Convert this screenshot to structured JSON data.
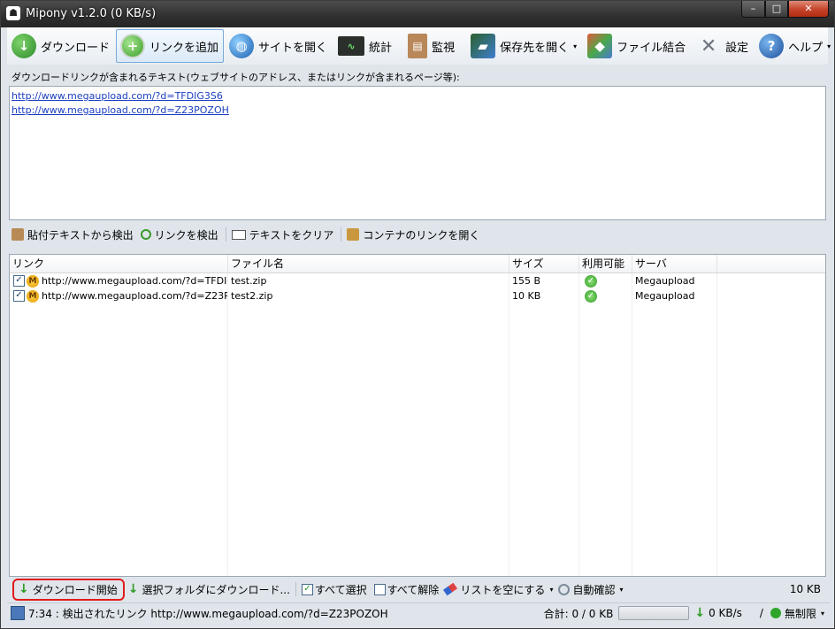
{
  "window": {
    "title": "Mipony v1.2.0 (0 KB/s)",
    "minimize": "–",
    "maximize": "□",
    "close": "✕"
  },
  "toolbar": {
    "items": [
      {
        "label": "ダウンロード",
        "icon": "download-globe-icon"
      },
      {
        "label": "リンクを追加",
        "icon": "add-link-icon"
      },
      {
        "label": "サイトを開く",
        "icon": "globe-icon"
      },
      {
        "label": "統計",
        "icon": "stats-monitor-icon"
      },
      {
        "label": "監視",
        "icon": "clipboard-icon"
      },
      {
        "label": "保存先を開く",
        "icon": "folder-open-icon"
      },
      {
        "label": "ファイル結合",
        "icon": "file-join-icon"
      },
      {
        "label": "設定",
        "icon": "tools-icon"
      },
      {
        "label": "ヘルプ",
        "icon": "help-icon"
      }
    ],
    "dropdown_arrow": "▾"
  },
  "hint": "ダウンロードリンクが含まれるテキスト(ウェブサイトのアドレス、またはリンクが含まれるページ等):",
  "paste_text": {
    "lines": [
      "http://www.megaupload.com/?d=TFDIG3S6",
      "http://www.megaupload.com/?d=Z23POZOH"
    ]
  },
  "subbar": {
    "detect_paste": "貼付テキストから検出",
    "detect_links": "リンクを検出",
    "clear_text": "テキストをクリア",
    "open_container": "コンテナのリンクを開く"
  },
  "list": {
    "headers": {
      "link": "リンク",
      "file": "ファイル名",
      "size": "サイズ",
      "available": "利用可能",
      "server": "サーバ"
    },
    "rows": [
      {
        "checked": "✓",
        "link": "http://www.megaupload.com/?d=TFDI...",
        "file": "test.zip",
        "size": "155 B",
        "available": "✓",
        "server": "Megaupload"
      },
      {
        "checked": "✓",
        "link": "http://www.megaupload.com/?d=Z23P...",
        "file": "test2.zip",
        "size": "10 KB",
        "available": "✓",
        "server": "Megaupload"
      }
    ]
  },
  "bottombar": {
    "start_download": "ダウンロード開始",
    "download_to_folder": "選択フォルダにダウンロード...",
    "select_all": "すべて選択",
    "deselect_all": "すべて解除",
    "clear_list": "リストを空にする",
    "auto_check": "自動確認",
    "total_size": "10 KB"
  },
  "statusbar": {
    "message": "7:34 : 検出されたリンク http://www.megaupload.com/?d=Z23POZOH",
    "total": "合計: 0 / 0 KB",
    "speed": "0 KB/s",
    "separator": "/",
    "limit": "無制限"
  }
}
